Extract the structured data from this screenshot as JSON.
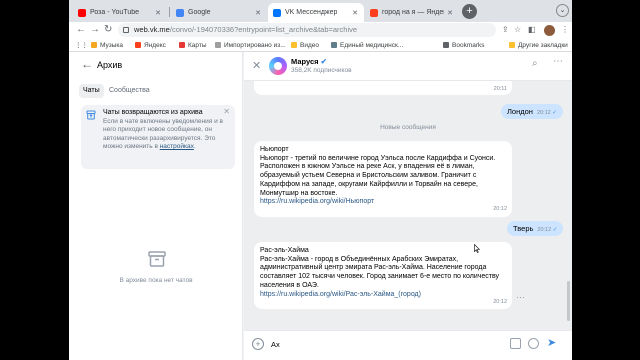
{
  "browser": {
    "tabs": [
      {
        "title": "Роза - YouTube",
        "favicon_color": "#ff0000"
      },
      {
        "title": "Google",
        "favicon_color": "#4285f4"
      },
      {
        "title": "VK Мессенджер",
        "favicon_color": "#0077ff"
      },
      {
        "title": "город на я — Яндекс",
        "favicon_color": "#fc3f1d"
      }
    ],
    "address": {
      "host": "web.vk.me",
      "path": "/convo/-194070336?entrypoint=list_archive&tab=archive"
    },
    "bookmarks": [
      {
        "label": "Музыка",
        "color": "#f5a623"
      },
      {
        "label": "Яндекс",
        "color": "#fc3f1d"
      },
      {
        "label": "Карты",
        "color": "#e53935"
      },
      {
        "label": "Импортировано из...",
        "color": "#9e9e9e"
      },
      {
        "label": "Видео",
        "color": "#fbc02d"
      },
      {
        "label": "Единый медицинск...",
        "color": "#607d8b"
      },
      {
        "label": "Bookmarks",
        "color": "#5f6368"
      },
      {
        "label": "Другие закладки",
        "color": "#fbc02d"
      }
    ]
  },
  "sidebar": {
    "title": "Архив",
    "tabs": [
      {
        "label": "Чаты"
      },
      {
        "label": "Сообщества"
      }
    ],
    "info": {
      "heading": "Чаты возвращаются из архива",
      "body": "Если в чате включены уведомления и в него приходит новое сообщение, он автоматически разархивируется. Это можно изменить в ",
      "link": "настройках",
      "tail": "."
    },
    "empty_text": "В архиве пока нет чатов"
  },
  "chat": {
    "name": "Маруся",
    "subscribers": "358,2K подписчиков",
    "top_time": "20:11",
    "messages": [
      {
        "dir": "out",
        "text": "Лондон",
        "time": "20:12"
      },
      {
        "dir": "divider",
        "text": "Новые сообщения"
      },
      {
        "dir": "in",
        "title": "Ньюпорт",
        "text": "Ньюпорт - третий по величине город Уэльса после Кардиффа и Суонси. Расположен в южном Уэльсе на реке Аск, у впадения её в лиман, образуемый устьем Северна и Бристольским заливом. Граничит с Кардиффом на западе, округами Кайрфилли и Торвайн на севере, Монмутшир на востоке.",
        "link": "https://ru.wikipedia.org/wiki/Ньюпорт",
        "time": "20:12"
      },
      {
        "dir": "out",
        "text": "Тверь",
        "time": "20:12"
      },
      {
        "dir": "in",
        "title": "Рас-эль-Хайма",
        "text": "Рас-эль-Хайма - город в Объединённых Арабских Эмиратах, административный центр эмирата Рас-эль-Хайма. Население города составляет 102 тысячи человек. Город занимает 6-е место по количеству населения в ОАЭ.",
        "link": "https://ru.wikipedia.org/wiki/Рас-эль-Хайма_(город)",
        "time": "20:12"
      }
    ],
    "composer_value": "Ах"
  },
  "colors": {
    "accent": "#3f8ae0",
    "out_bubble": "#cce4ff",
    "bg": "#edeef0"
  }
}
